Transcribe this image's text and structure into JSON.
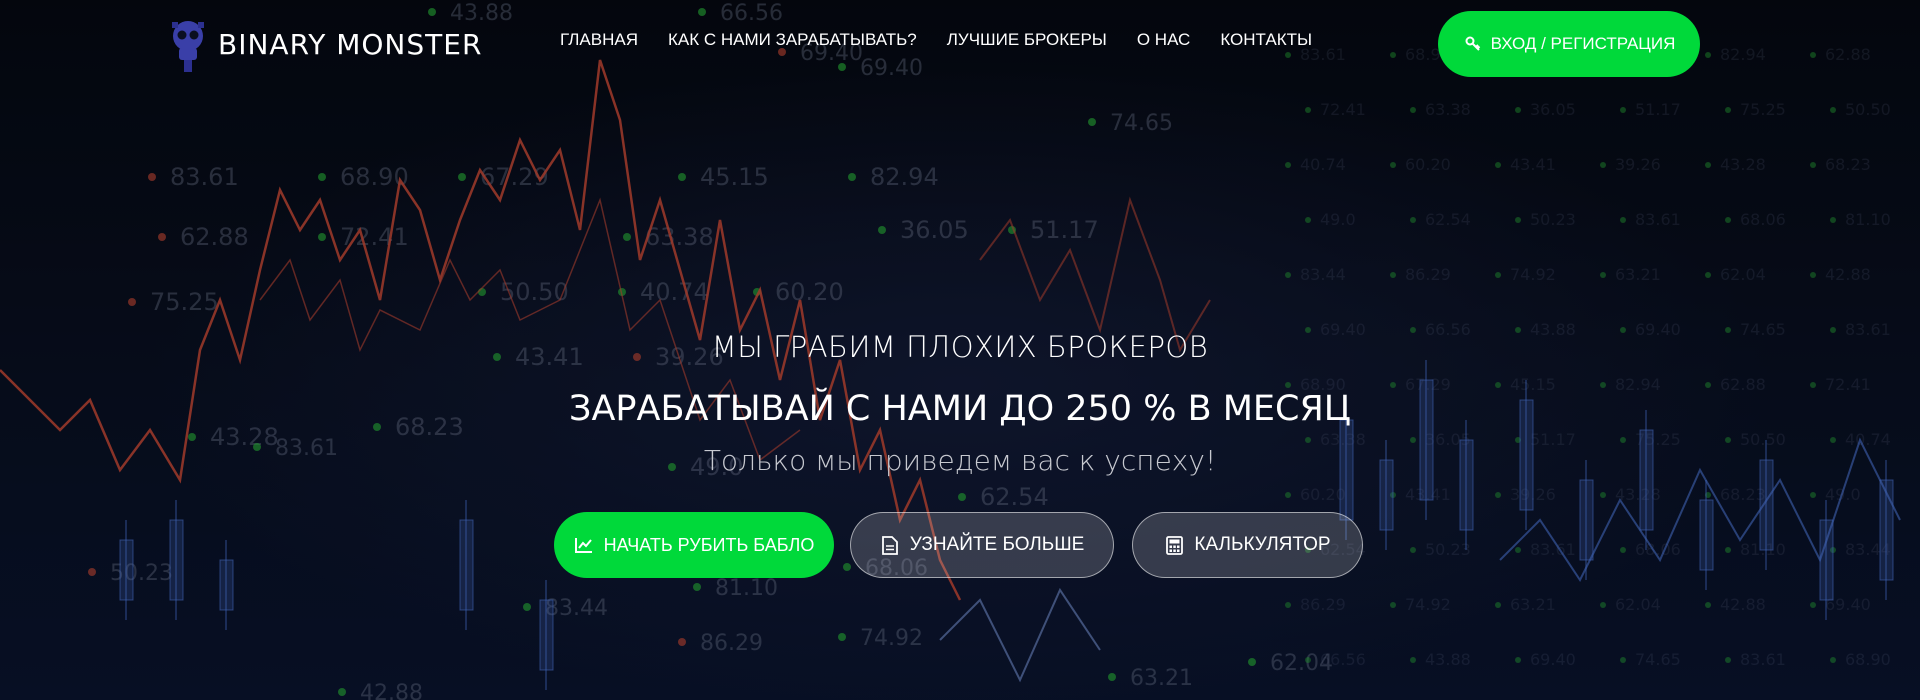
{
  "brand": {
    "logo_text": "BINARY MONSTER"
  },
  "nav": {
    "items": [
      {
        "label": "ГЛАВНАЯ"
      },
      {
        "label": "КАК С НАМИ ЗАРАБАТЫВАТЬ?"
      },
      {
        "label": "ЛУЧШИЕ БРОКЕРЫ"
      },
      {
        "label": "О НАС"
      },
      {
        "label": "КОНТАКТЫ"
      }
    ],
    "login_label": "ВХОД / РЕГИСТРАЦИЯ"
  },
  "hero": {
    "subtitle": "МЫ ГРАБИМ ПЛОХИХ БРОКЕРОВ",
    "title": "ЗАРАБАТЫВАЙ С НАМИ ДО 250 % В МЕСЯЦ",
    "tagline": "Только мы приведем вас к успеху!",
    "buttons": {
      "start": "НАЧАТЬ РУБИТЬ БАБЛО",
      "more": "УЗНАЙТЕ БОЛЬШЕ",
      "calc": "КАЛЬКУЛЯТОР"
    }
  },
  "background_numbers": [
    "83.61",
    "68.90",
    "67.29",
    "45.15",
    "82.94",
    "62.88",
    "72.41",
    "63.38",
    "36.05",
    "51.17",
    "75.25",
    "50.50",
    "40.74",
    "60.20",
    "43.41",
    "39.26",
    "43.28",
    "68.23",
    "49.0",
    "62.54",
    "50.23",
    "83.61",
    "68.06",
    "81.10",
    "83.44",
    "86.29",
    "74.92",
    "63.21",
    "62.04",
    "42.88",
    "69.40",
    "66.56",
    "43.88",
    "69.40",
    "74.65"
  ],
  "colors": {
    "accent_green": "#00d93a",
    "chart_red": "#e5533d",
    "chart_blue": "#5a8cff",
    "ticker_green": "#2ecc40"
  }
}
